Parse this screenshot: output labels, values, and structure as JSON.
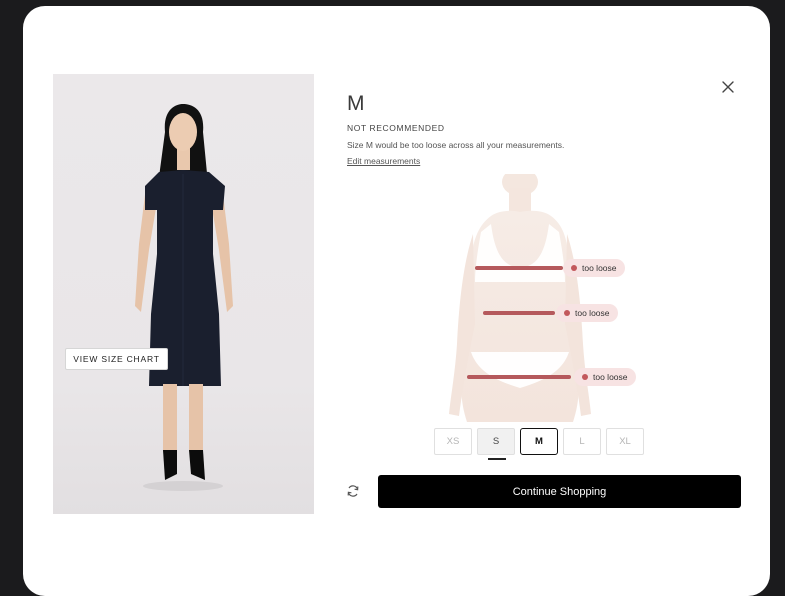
{
  "product": {
    "image_alt": "Model wearing a navy short-sleeve knee-length sheath dress",
    "view_size_chart_label": "VIEW SIZE CHART"
  },
  "recommendation": {
    "size": "M",
    "status": "NOT RECOMMENDED",
    "description": "Size M would be too loose across all your measurements.",
    "edit_link": "Edit measurements"
  },
  "fit_markers": [
    {
      "label": "too loose"
    },
    {
      "label": "too loose"
    },
    {
      "label": "too loose"
    }
  ],
  "size_options": [
    {
      "label": "XS",
      "state": "unavailable"
    },
    {
      "label": "S",
      "state": "current"
    },
    {
      "label": "M",
      "state": "selected"
    },
    {
      "label": "L",
      "state": "unavailable"
    },
    {
      "label": "XL",
      "state": "unavailable"
    }
  ],
  "actions": {
    "continue_label": "Continue Shopping",
    "refresh_icon": "refresh-icon",
    "close_icon": "close-icon"
  },
  "colors": {
    "accent": "#000000",
    "fit_line": "#b5595c",
    "fit_tag_bg": "#f7e3e3",
    "dress": "#1a1f2e"
  }
}
